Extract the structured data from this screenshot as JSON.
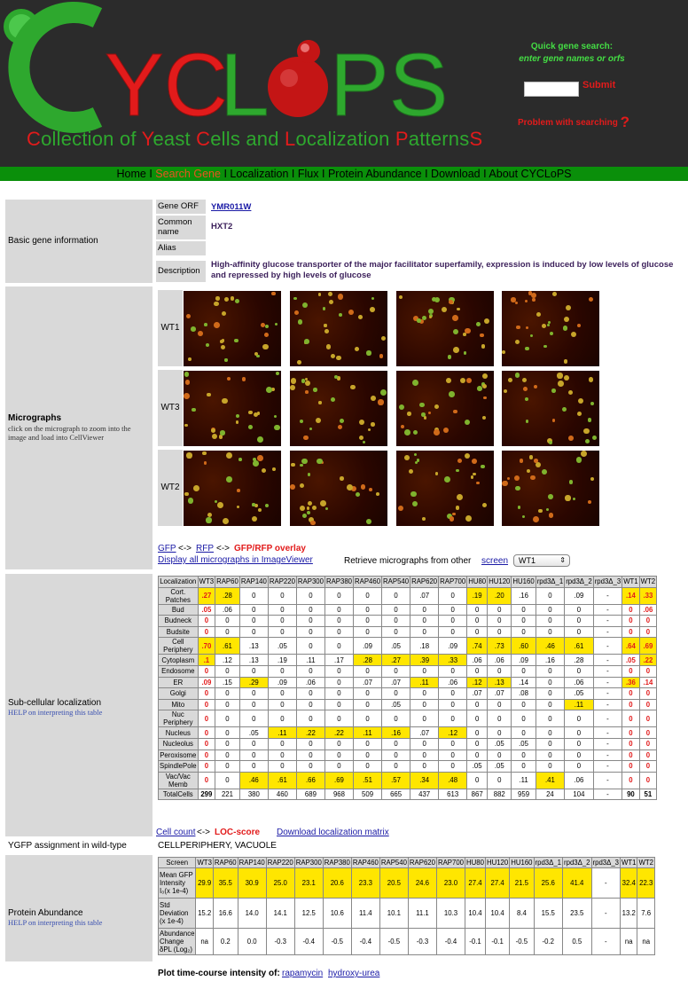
{
  "header": {
    "logo_text": "CYCLoPS",
    "tagline_parts": [
      {
        "cap": "C",
        "rest": "ollection of "
      },
      {
        "cap": "Y",
        "rest": "east "
      },
      {
        "cap": "C",
        "rest": "ells and "
      },
      {
        "cap": "L",
        "rest": "ocalization "
      },
      {
        "cap": "P",
        "rest": "atterns"
      },
      {
        "cap": "S",
        "rest": ""
      }
    ],
    "quick_search_title": "Quick gene search:",
    "quick_search_hint": "enter gene names or orfs",
    "search_value": "",
    "submit_label": "Submit",
    "problem_label": "Problem with searching",
    "problem_mark": "?",
    "colors": {
      "background": "#2b2b2b",
      "green": "#2ea82e",
      "red": "#e21b1b"
    }
  },
  "nav": {
    "items": [
      "Home",
      "Search Gene",
      "Localization",
      "Flux",
      "Protein Abundance",
      "Download",
      "About CYCLoPS"
    ],
    "separator": "I",
    "current": "Search Gene",
    "bar_color": "#0a8f0a"
  },
  "basic": {
    "section_label": "Basic gene information",
    "orf_label": "Gene ORF",
    "orf_value": "YMR011W",
    "common_label": "Common name",
    "common_value": "HXT2",
    "alias_label": "Alias",
    "alias_value": "",
    "desc_label": "Description",
    "desc_value": "High-affinity glucose transporter of the major facilitator superfamily, expression is induced by low levels of glucose and repressed by high levels of glucose"
  },
  "micrographs": {
    "section_label": "Micrographs",
    "help_text": "click on the micrograph to zoom into the image and load into CellViewer",
    "rows": [
      "WT1",
      "WT3",
      "WT2"
    ],
    "gfp_link": "GFP",
    "arrow": "<->",
    "rfp_link": "RFP",
    "overlay_label": "GFP/RFP overlay",
    "imageviewer_link": "Display all micrographs in ImageViewer",
    "retrieve_text": "Retrieve micrographs from other",
    "screen_link": "screen",
    "screen_selected": "WT1"
  },
  "localization": {
    "section_label": "Sub-cellular localization",
    "help_link": "HELP on interpreting this table",
    "headers": [
      "Localization",
      "WT3",
      "RAP60",
      "RAP140",
      "RAP220",
      "RAP300",
      "RAP380",
      "RAP460",
      "RAP540",
      "RAP620",
      "RAP700",
      "HU80",
      "HU120",
      "HU160",
      "rpd3Δ_1",
      "rpd3Δ_2",
      "rpd3Δ_3",
      "WT1",
      "WT2"
    ],
    "rows": [
      {
        "label": "Cort. Patches",
        "values": [
          ".27",
          ".28",
          "0",
          "0",
          "0",
          "0",
          "0",
          "0",
          ".07",
          "0",
          ".19",
          ".20",
          ".16",
          "0",
          ".09",
          "-",
          ".14",
          ".33"
        ]
      },
      {
        "label": "Bud",
        "values": [
          ".05",
          ".06",
          "0",
          "0",
          "0",
          "0",
          "0",
          "0",
          "0",
          "0",
          "0",
          "0",
          "0",
          "0",
          "0",
          "-",
          "0",
          ".06"
        ]
      },
      {
        "label": "Budneck",
        "values": [
          "0",
          "0",
          "0",
          "0",
          "0",
          "0",
          "0",
          "0",
          "0",
          "0",
          "0",
          "0",
          "0",
          "0",
          "0",
          "-",
          "0",
          "0"
        ]
      },
      {
        "label": "Budsite",
        "values": [
          "0",
          "0",
          "0",
          "0",
          "0",
          "0",
          "0",
          "0",
          "0",
          "0",
          "0",
          "0",
          "0",
          "0",
          "0",
          "-",
          "0",
          "0"
        ]
      },
      {
        "label": "Cell Periphery",
        "values": [
          ".70",
          ".61",
          ".13",
          ".05",
          "0",
          "0",
          ".09",
          ".05",
          ".18",
          ".09",
          ".74",
          ".73",
          ".60",
          ".46",
          ".61",
          "-",
          ".64",
          ".69"
        ]
      },
      {
        "label": "Cytoplasm",
        "values": [
          ".1",
          ".12",
          ".13",
          ".19",
          ".11",
          ".17",
          ".28",
          ".27",
          ".39",
          ".33",
          ".06",
          ".06",
          ".09",
          ".16",
          ".28",
          "-",
          ".05",
          ".22"
        ]
      },
      {
        "label": "Endosome",
        "values": [
          "0",
          "0",
          "0",
          "0",
          "0",
          "0",
          "0",
          "0",
          "0",
          "0",
          "0",
          "0",
          "0",
          "0",
          "0",
          "-",
          "0",
          "0"
        ]
      },
      {
        "label": "ER",
        "values": [
          ".09",
          ".15",
          ".29",
          ".09",
          ".06",
          "0",
          ".07",
          ".07",
          ".11",
          ".06",
          ".12",
          ".13",
          ".14",
          "0",
          ".06",
          "-",
          ".36",
          ".14"
        ]
      },
      {
        "label": "Golgi",
        "values": [
          "0",
          "0",
          "0",
          "0",
          "0",
          "0",
          "0",
          "0",
          "0",
          "0",
          ".07",
          ".07",
          ".08",
          "0",
          ".05",
          "-",
          "0",
          "0"
        ]
      },
      {
        "label": "Mito",
        "values": [
          "0",
          "0",
          "0",
          "0",
          "0",
          "0",
          "0",
          ".05",
          "0",
          "0",
          "0",
          "0",
          "0",
          "0",
          ".11",
          "-",
          "0",
          "0"
        ]
      },
      {
        "label": "Nuc Periphery",
        "values": [
          "0",
          "0",
          "0",
          "0",
          "0",
          "0",
          "0",
          "0",
          "0",
          "0",
          "0",
          "0",
          "0",
          "0",
          "0",
          "-",
          "0",
          "0"
        ]
      },
      {
        "label": "Nucleus",
        "values": [
          "0",
          "0",
          ".05",
          ".11",
          ".22",
          ".22",
          ".11",
          ".16",
          ".07",
          ".12",
          "0",
          "0",
          "0",
          "0",
          "0",
          "-",
          "0",
          "0"
        ]
      },
      {
        "label": "Nucleolus",
        "values": [
          "0",
          "0",
          "0",
          "0",
          "0",
          "0",
          "0",
          "0",
          "0",
          "0",
          "0",
          ".05",
          ".05",
          "0",
          "0",
          "-",
          "0",
          "0"
        ]
      },
      {
        "label": "Peroxisome",
        "values": [
          "0",
          "0",
          "0",
          "0",
          "0",
          "0",
          "0",
          "0",
          "0",
          "0",
          "0",
          "0",
          "0",
          "0",
          "0",
          "-",
          "0",
          "0"
        ]
      },
      {
        "label": "SpindlePole",
        "values": [
          "0",
          "0",
          "0",
          "0",
          "0",
          "0",
          "0",
          "0",
          "0",
          "0",
          ".05",
          ".05",
          "0",
          "0",
          "0",
          "-",
          "0",
          "0"
        ]
      },
      {
        "label": "Vac/Vac Memb",
        "values": [
          "0",
          "0",
          ".46",
          ".61",
          ".66",
          ".69",
          ".51",
          ".57",
          ".34",
          ".48",
          "0",
          "0",
          ".11",
          ".41",
          ".06",
          "-",
          "0",
          "0"
        ]
      },
      {
        "label": "TotalCells",
        "values": [
          "299",
          "221",
          "380",
          "460",
          "689",
          "968",
          "509",
          "665",
          "437",
          "613",
          "867",
          "882",
          "959",
          "24",
          "104",
          "-",
          "90",
          "51"
        ]
      }
    ],
    "highlighted": [
      [
        0,
        0
      ],
      [
        0,
        1
      ],
      [
        0,
        10
      ],
      [
        0,
        11
      ],
      [
        0,
        16
      ],
      [
        0,
        17
      ],
      [
        4,
        0
      ],
      [
        4,
        1
      ],
      [
        4,
        10
      ],
      [
        4,
        11
      ],
      [
        4,
        12
      ],
      [
        4,
        13
      ],
      [
        4,
        14
      ],
      [
        4,
        16
      ],
      [
        4,
        17
      ],
      [
        5,
        0
      ],
      [
        5,
        6
      ],
      [
        5,
        7
      ],
      [
        5,
        8
      ],
      [
        5,
        9
      ],
      [
        5,
        17
      ],
      [
        7,
        2
      ],
      [
        7,
        8
      ],
      [
        7,
        10
      ],
      [
        7,
        11
      ],
      [
        7,
        16
      ],
      [
        9,
        14
      ],
      [
        11,
        3
      ],
      [
        11,
        4
      ],
      [
        11,
        5
      ],
      [
        11,
        6
      ],
      [
        11,
        7
      ],
      [
        11,
        9
      ],
      [
        15,
        2
      ],
      [
        15,
        3
      ],
      [
        15,
        4
      ],
      [
        15,
        5
      ],
      [
        15,
        6
      ],
      [
        15,
        7
      ],
      [
        15,
        8
      ],
      [
        15,
        9
      ],
      [
        15,
        13
      ]
    ],
    "cell_count_link": "Cell count",
    "arrow": "<->",
    "loc_score_label": "LOC-score",
    "download_link": "Download localization matrix"
  },
  "ygfp": {
    "label": "YGFP assignment in wild-type",
    "value": "CELLPERIPHERY, VACUOLE"
  },
  "abundance": {
    "section_label": "Protein Abundance",
    "help_link": "HELP on interpreting this table",
    "headers": [
      "Screen",
      "WT3",
      "RAP60",
      "RAP140",
      "RAP220",
      "RAP300",
      "RAP380",
      "RAP460",
      "RAP540",
      "RAP620",
      "RAP700",
      "HU80",
      "HU120",
      "HU160",
      "rpd3Δ_1",
      "rpd3Δ_2",
      "rpd3Δ_3",
      "WT1",
      "WT2"
    ],
    "rows": [
      {
        "label": "Mean GFP Intensity I₀(x 1e-4)",
        "values": [
          "29.9",
          "35.5",
          "30.9",
          "25.0",
          "23.1",
          "20.6",
          "23.3",
          "20.5",
          "24.6",
          "23.0",
          "27.4",
          "27.4",
          "21.5",
          "25.6",
          "41.4",
          "-",
          "32.4",
          "22.3"
        ]
      },
      {
        "label": "Std Deviation (x 1e-4)",
        "values": [
          "15.2",
          "16.6",
          "14.0",
          "14.1",
          "12.5",
          "10.6",
          "11.4",
          "10.1",
          "11.1",
          "10.3",
          "10.4",
          "10.4",
          "8.4",
          "15.5",
          "23.5",
          "-",
          "13.2",
          "7.6"
        ]
      },
      {
        "label": "Abundance Change δPL (Log₂)",
        "values": [
          "na",
          "0.2",
          "0.0",
          "-0.3",
          "-0.4",
          "-0.5",
          "-0.4",
          "-0.5",
          "-0.3",
          "-0.4",
          "-0.1",
          "-0.1",
          "-0.5",
          "-0.2",
          "0.5",
          "-",
          "na",
          "na"
        ]
      }
    ],
    "plot_label": "Plot time-course intensity of:",
    "rapamycin_link": "rapamycin",
    "hydroxyurea_link": "hydroxy-urea"
  }
}
